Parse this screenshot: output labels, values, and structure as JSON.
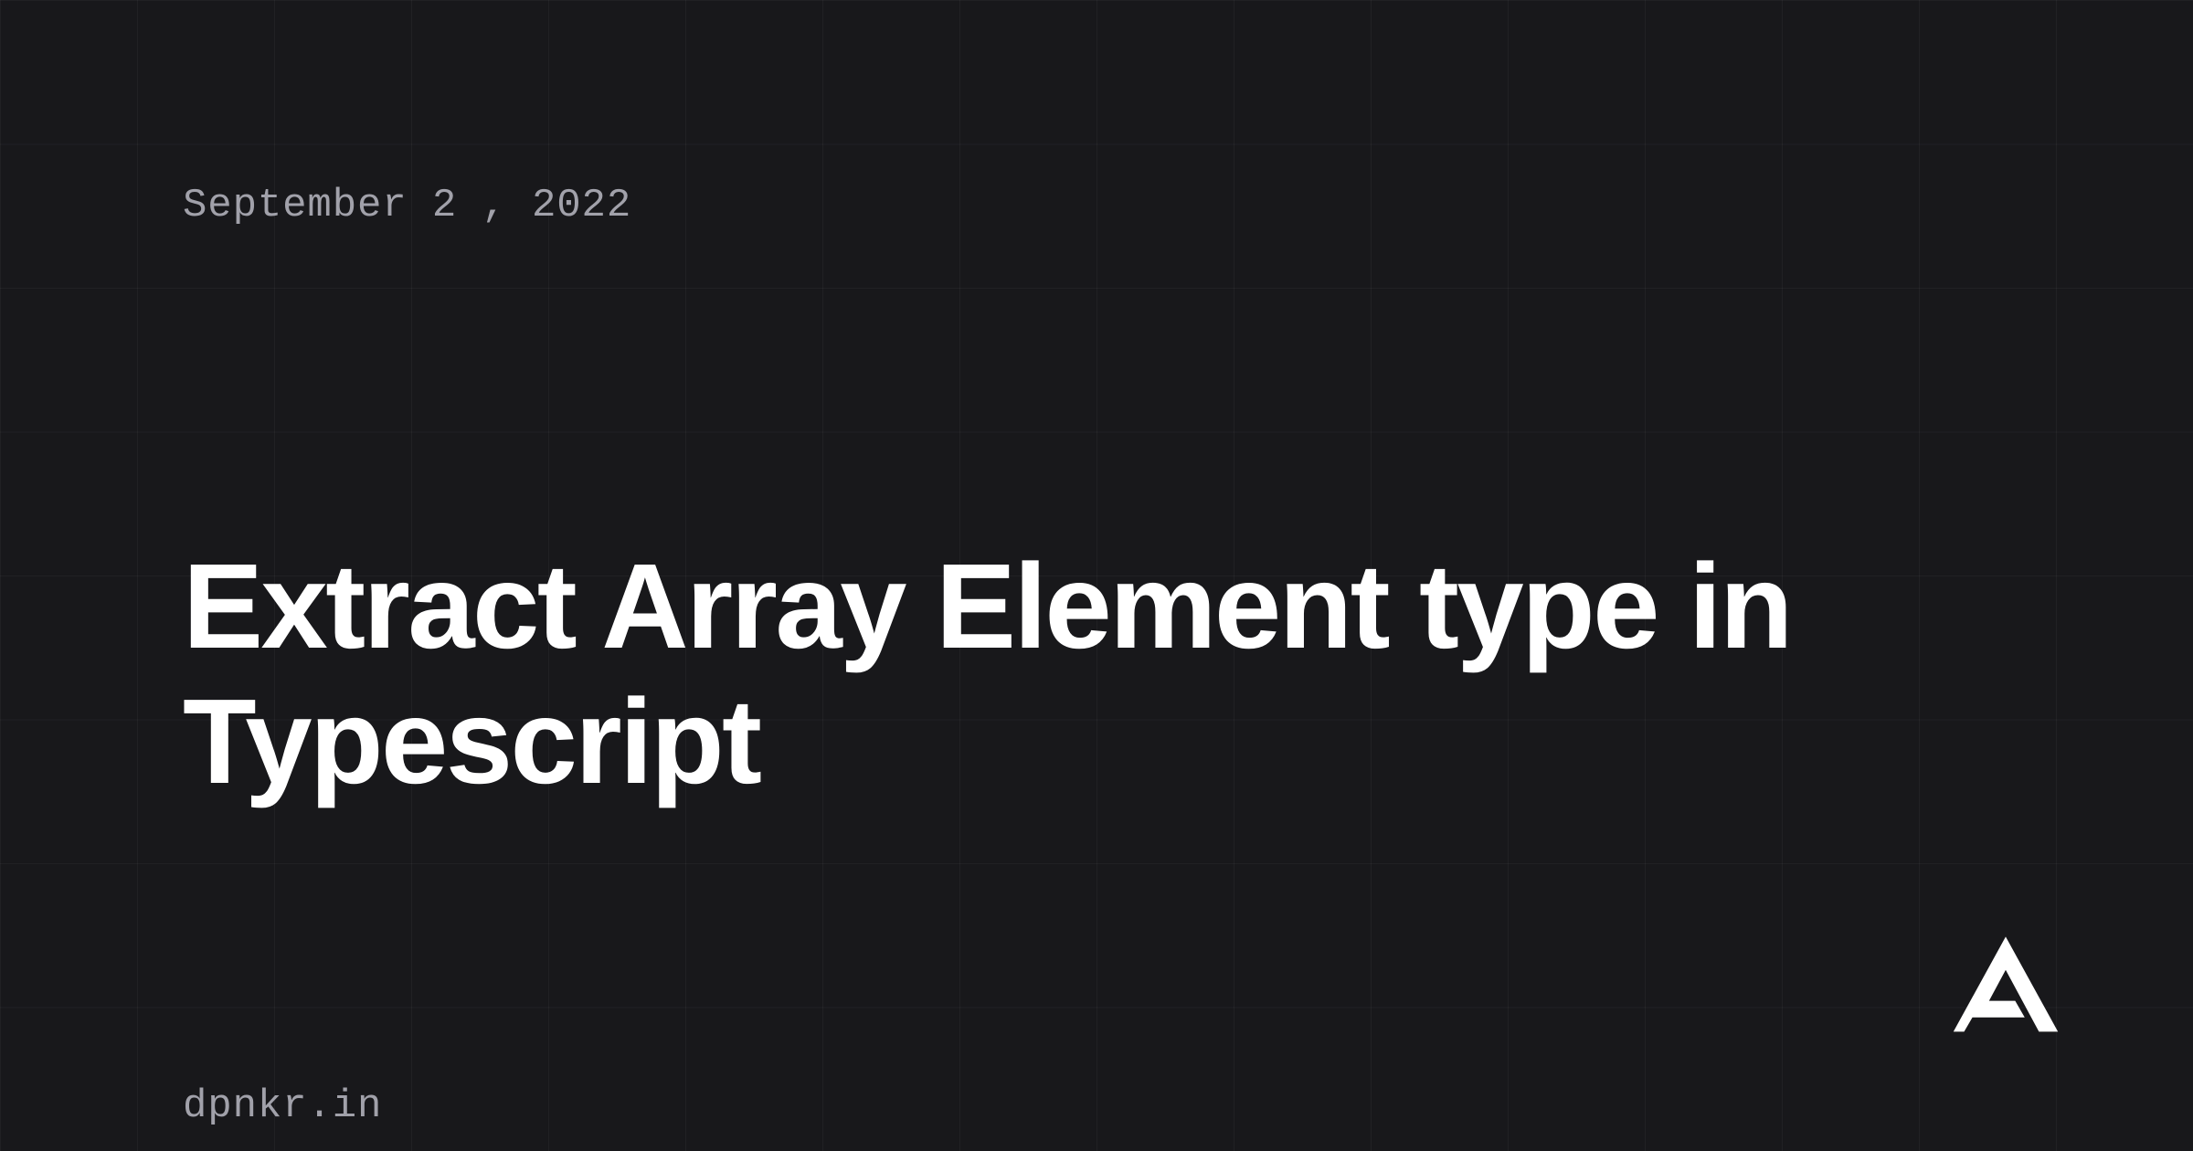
{
  "date": "September 2 , 2022",
  "title": "Extract Array Element type in Typescript",
  "domain": "dpnkr.in"
}
